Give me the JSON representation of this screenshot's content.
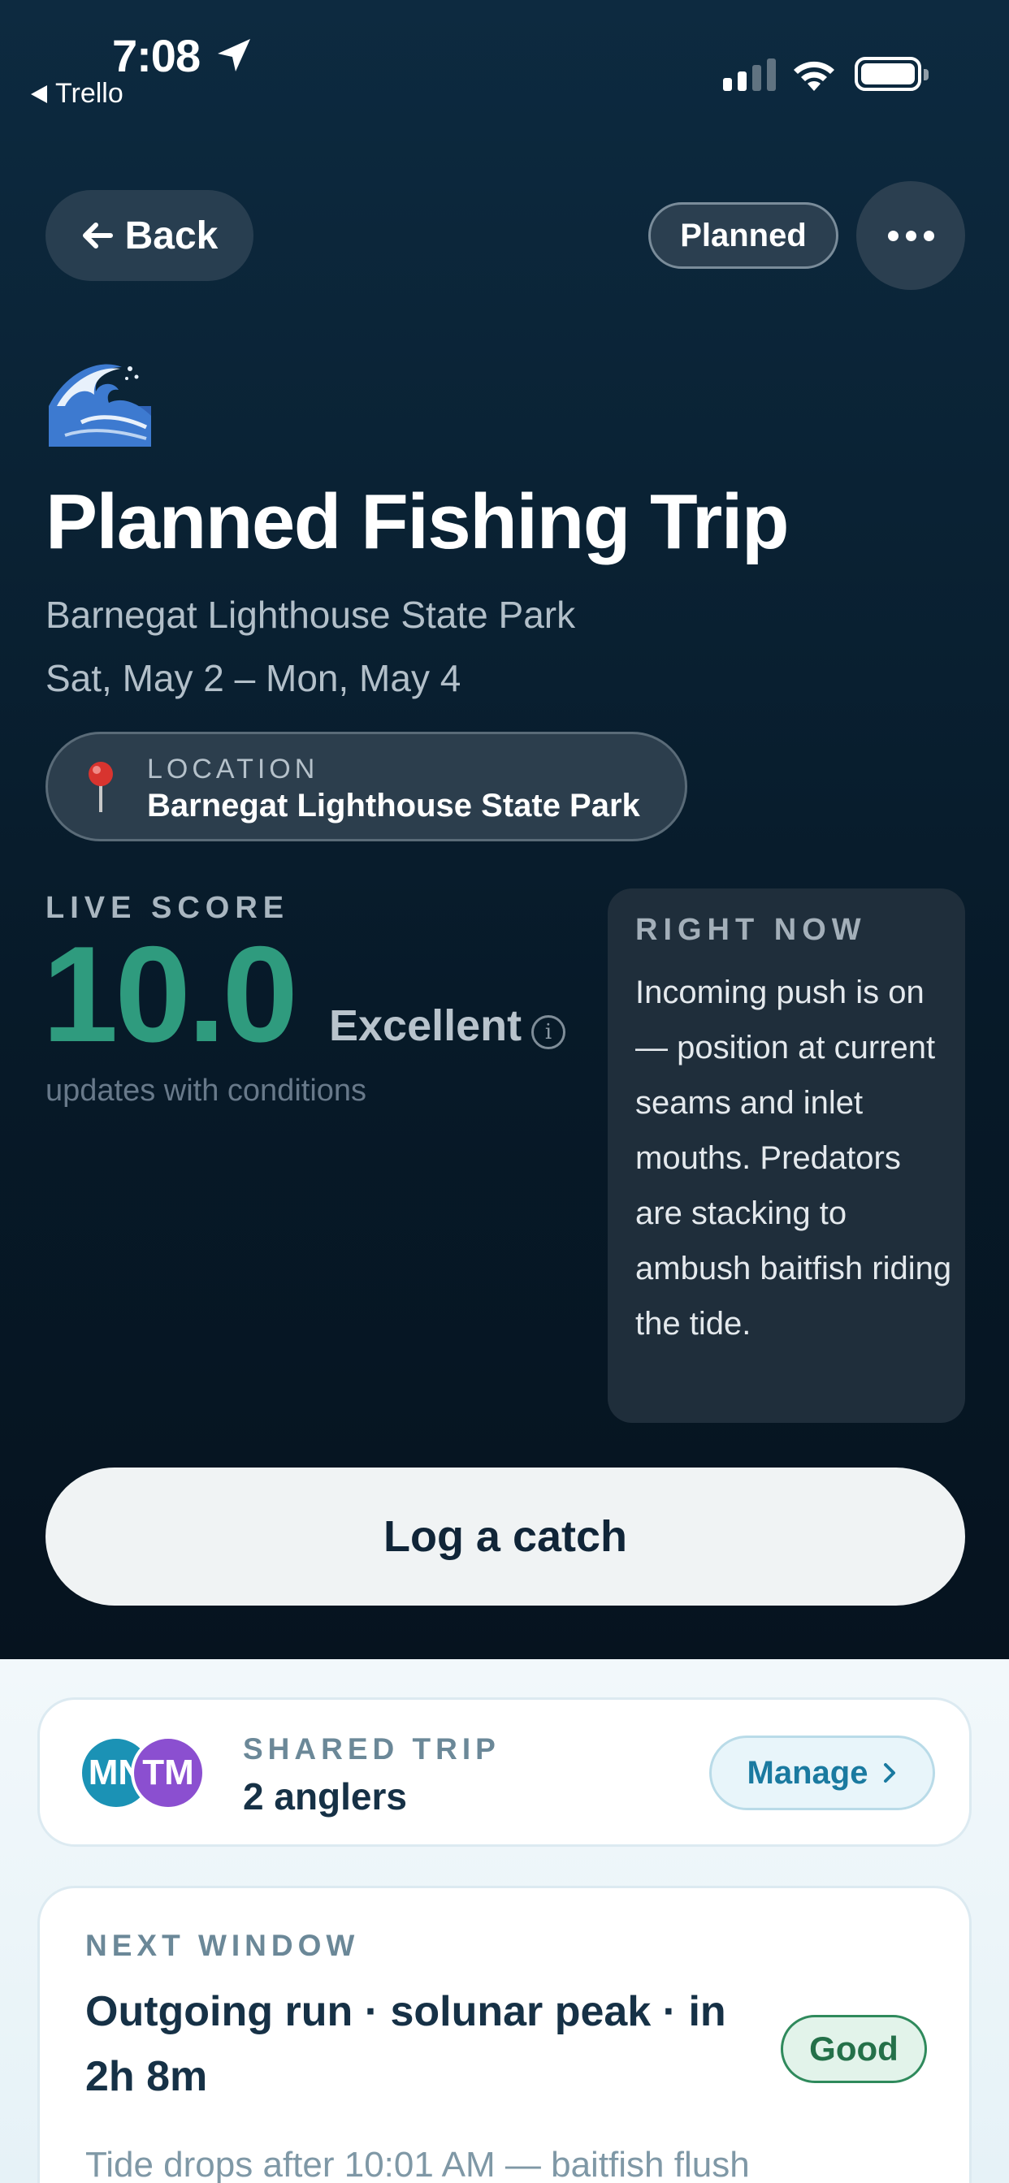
{
  "status_bar": {
    "time": "7:08",
    "back_app": "Trello"
  },
  "nav": {
    "back_label": "Back",
    "status_pill": "Planned"
  },
  "trip": {
    "icon": "ocean-wave-icon",
    "title": "Planned Fishing Trip",
    "place": "Barnegat Lighthouse State Park",
    "dates": "Sat, May 2 – Mon, May 4",
    "location_label": "LOCATION",
    "location_value": "Barnegat Lighthouse State Park"
  },
  "live_score": {
    "label": "LIVE SCORE",
    "value": "10.0",
    "rating": "Excellent",
    "caption": "updates with conditions",
    "score_color": "#2f9b7e"
  },
  "right_now": {
    "label": "RIGHT NOW",
    "text": "Incoming push is on — position at current seams and inlet mouths. Predators are stacking to ambush baitfish riding the tide."
  },
  "actions": {
    "log_catch": "Log a catch"
  },
  "shared_trip": {
    "label": "SHARED TRIP",
    "value": "2 anglers",
    "avatars": [
      {
        "initials": "MN",
        "color": "#1b92b5"
      },
      {
        "initials": "TM",
        "color": "#8b4fd0"
      }
    ],
    "manage_label": "Manage"
  },
  "next_window": {
    "label": "NEXT WINDOW",
    "title": "Outgoing run · solunar peak · in 2h 8m",
    "badge": "Good",
    "description": "Tide drops after 10:01 AM — baitfish flush"
  }
}
